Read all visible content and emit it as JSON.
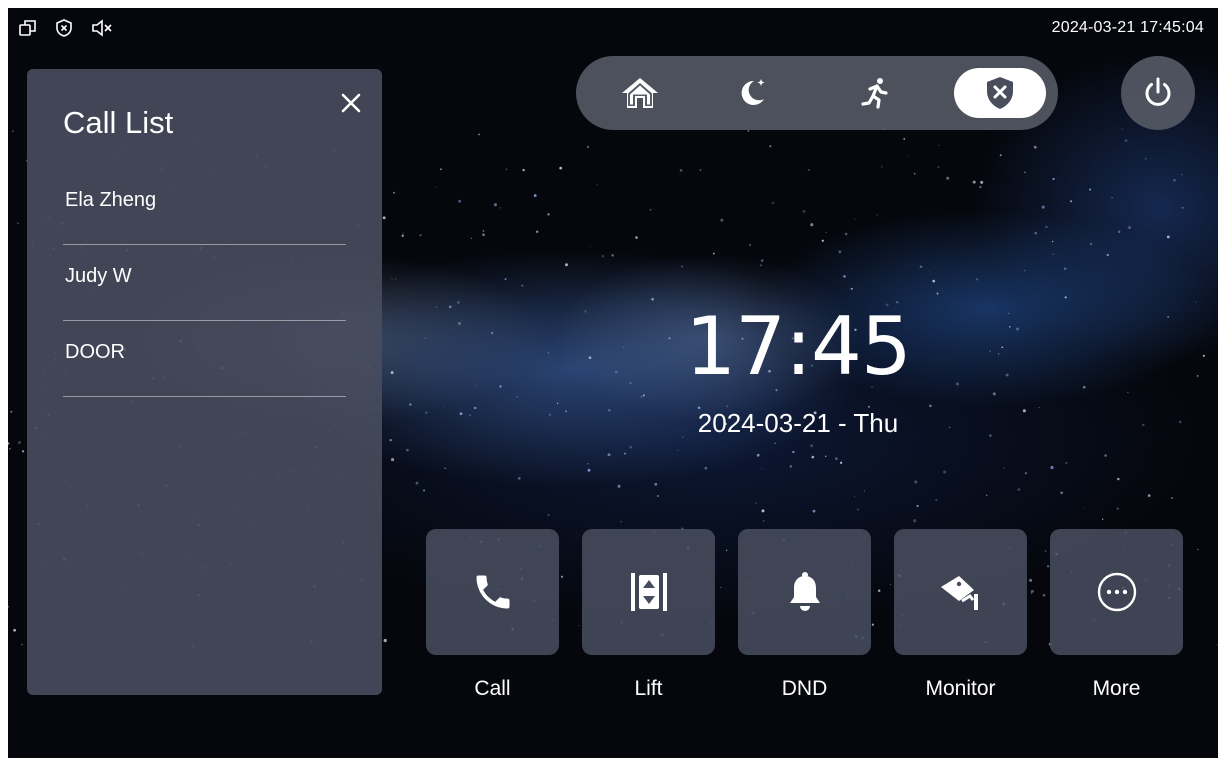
{
  "status_bar": {
    "icons": [
      "window-icon",
      "shield-x-icon",
      "speaker-mute-icon"
    ],
    "datetime": "2024-03-21 17:45:04"
  },
  "call_list": {
    "title": "Call List",
    "items": [
      {
        "label": "Ela Zheng"
      },
      {
        "label": "Judy W"
      },
      {
        "label": "DOOR"
      }
    ]
  },
  "modes": {
    "items": [
      "home-icon",
      "moon-icon",
      "running-person-icon",
      "shield-x-icon"
    ],
    "active": "shield-x-icon"
  },
  "clock": {
    "time": "17:45",
    "date": "2024-03-21 - Thu"
  },
  "functions": [
    {
      "label": "Call",
      "icon": "phone-icon"
    },
    {
      "label": "Lift",
      "icon": "elevator-icon"
    },
    {
      "label": "DND",
      "icon": "bell-icon"
    },
    {
      "label": "Monitor",
      "icon": "camera-icon"
    },
    {
      "label": "More",
      "icon": "more-dots-icon"
    }
  ],
  "colors": {
    "panel": "#484d5e",
    "mode_bar": "#585c68",
    "background": "#05070d",
    "text": "#ffffff"
  }
}
